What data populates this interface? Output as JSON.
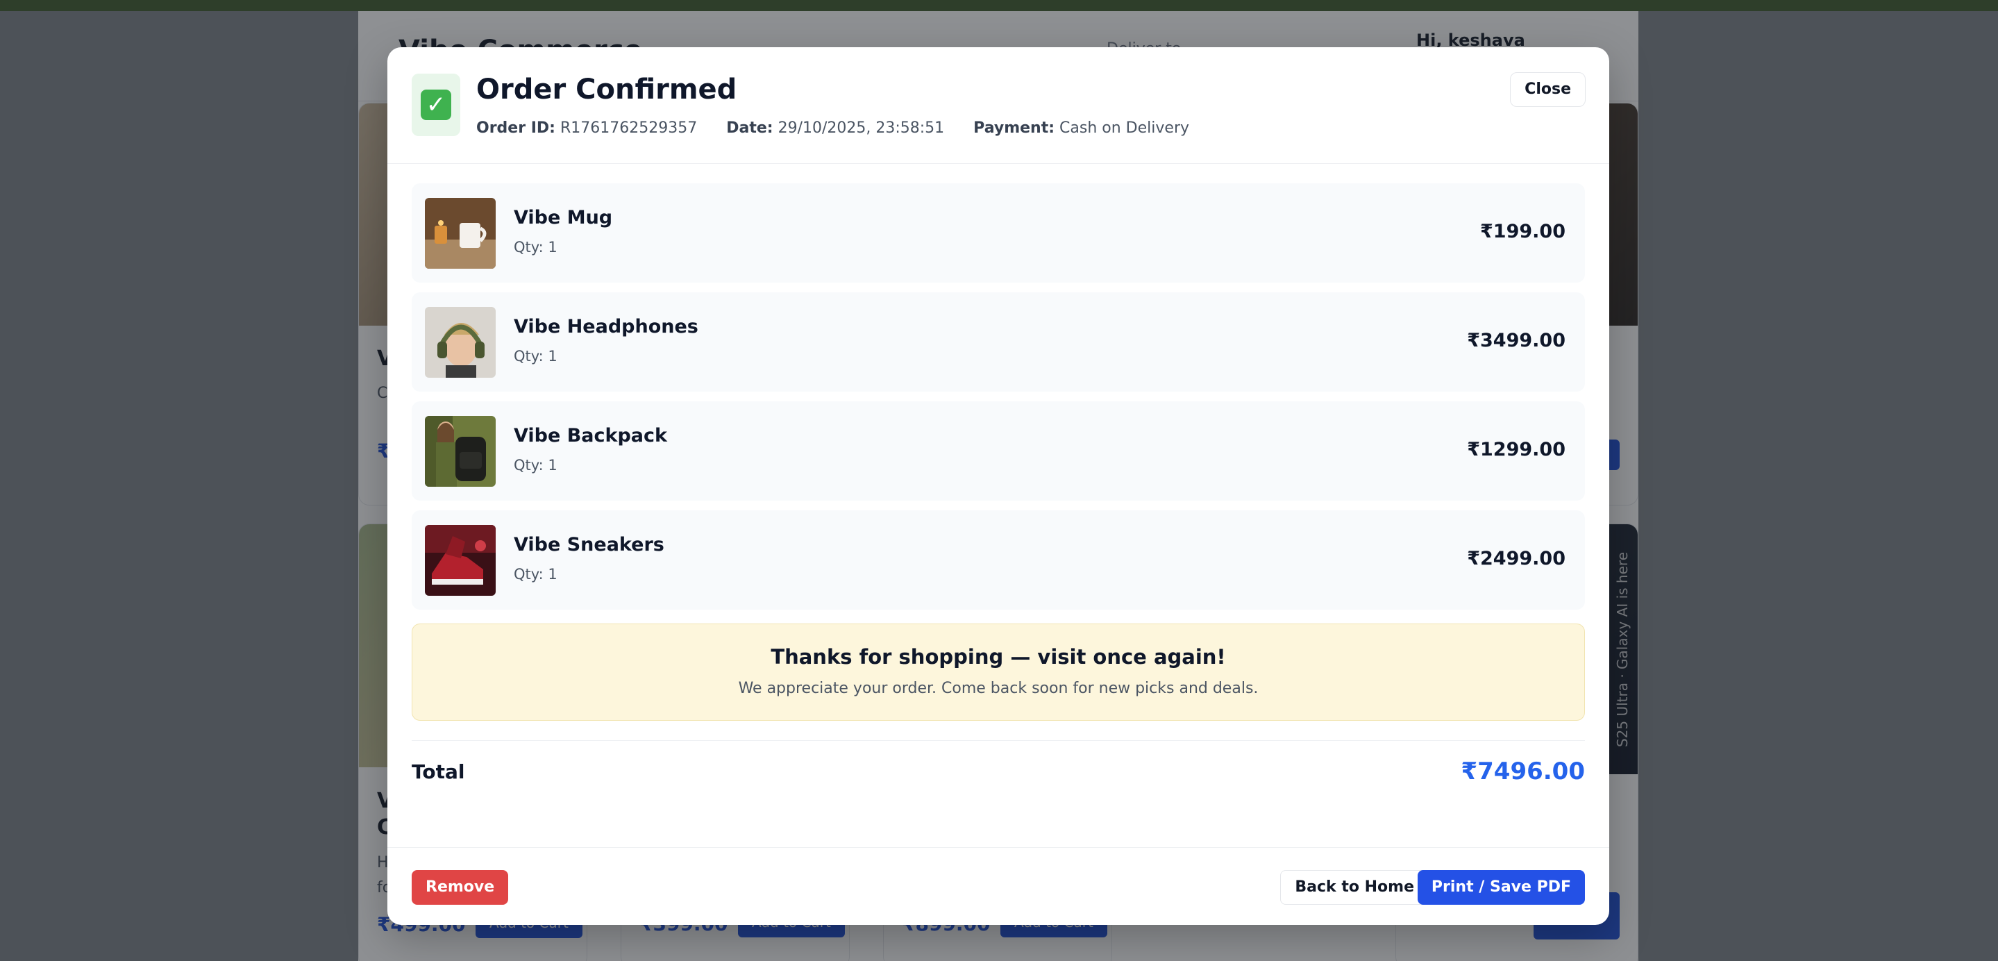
{
  "background": {
    "brand": "Vibe Commerce",
    "deliver_label": "Deliver to",
    "greeting": "Hi, keshava",
    "cards": [
      {
        "title": "V",
        "desc": "C\nc",
        "price": "₹",
        "add_label": ""
      },
      {
        "title": "V\nC",
        "desc": "H\nfo",
        "price": "₹499.00",
        "add_label": "Add to Cart"
      },
      {
        "title": "",
        "desc": "",
        "price": "₹399.00",
        "add_label": "Add to Cart"
      },
      {
        "title": "",
        "desc": "",
        "price": "₹899.00",
        "add_label": "Add to Cart"
      }
    ],
    "promo_text": "S25 Ultra · Galaxy AI is here"
  },
  "modal": {
    "check_icon": "check-mark-icon",
    "title": "Order Confirmed",
    "close_label": "Close",
    "meta": {
      "order_id_label": "Order ID:",
      "order_id": "R1761762529357",
      "date_label": "Date:",
      "date": "29/10/2025, 23:58:51",
      "payment_label": "Payment:",
      "payment": "Cash on Delivery"
    },
    "items": [
      {
        "name": "Vibe Mug",
        "qty": "Qty: 1",
        "price": "₹199.00"
      },
      {
        "name": "Vibe Headphones",
        "qty": "Qty: 1",
        "price": "₹3499.00"
      },
      {
        "name": "Vibe Backpack",
        "qty": "Qty: 1",
        "price": "₹1299.00"
      },
      {
        "name": "Vibe Sneakers",
        "qty": "Qty: 1",
        "price": "₹2499.00"
      }
    ],
    "thanks": {
      "title": "Thanks for shopping — visit once again!",
      "subtitle": "We appreciate your order. Come back soon for new picks and deals."
    },
    "total_label": "Total",
    "total_value": "₹7496.00",
    "footer": {
      "remove_label": "Remove",
      "home_label": "Back to Home",
      "print_label": "Print / Save PDF"
    },
    "colors": {
      "accent": "#2563eb",
      "danger": "#e04545",
      "success": "#3fb24f",
      "notice_bg": "#fdf6dc"
    }
  }
}
